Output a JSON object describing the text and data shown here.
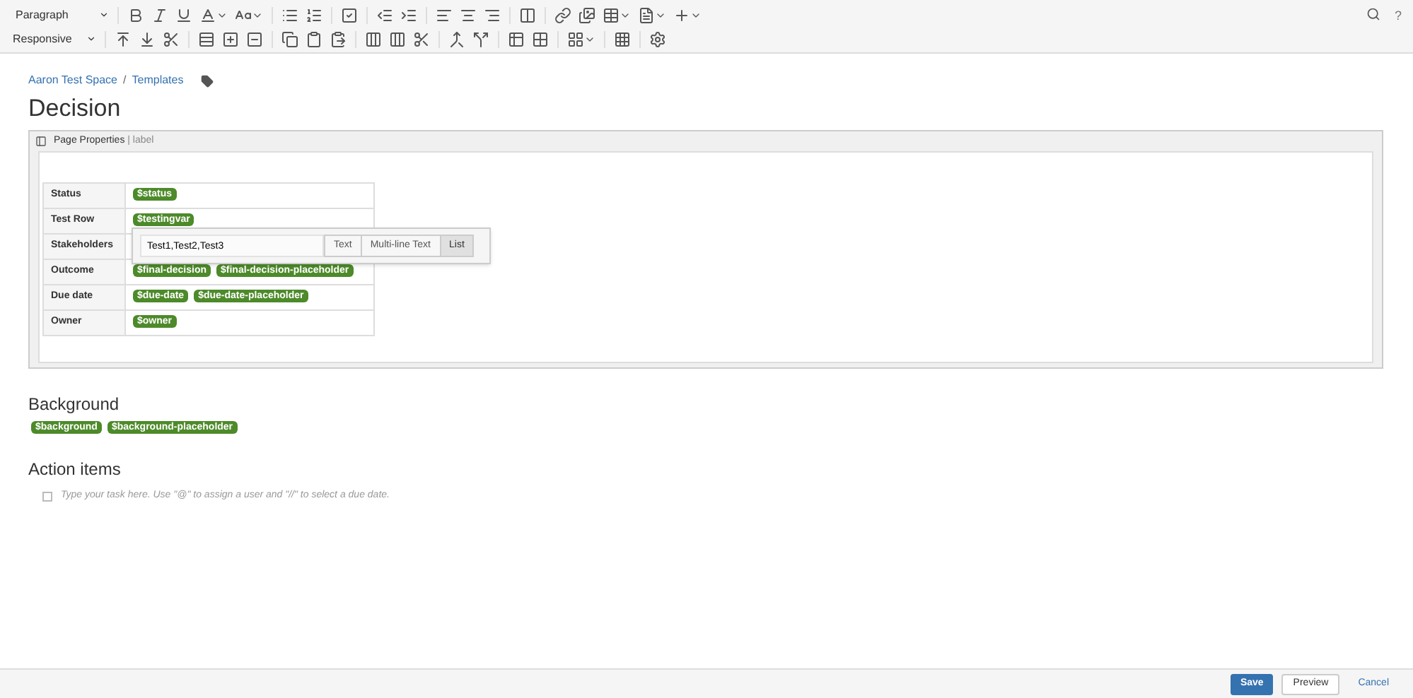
{
  "toolbar": {
    "format_dropdown": "Paragraph",
    "layout_dropdown": "Responsive",
    "help": "?"
  },
  "breadcrumbs": [
    {
      "label": "Aaron Test Space"
    },
    {
      "label": "Templates"
    }
  ],
  "breadcrumb_separator": "/",
  "title": "Decision",
  "macro": {
    "name": "Page Properties",
    "params": "| label"
  },
  "properties": [
    {
      "label": "Status",
      "values": [
        "$status"
      ]
    },
    {
      "label": "Test Row",
      "values": [
        "$testingvar"
      ]
    },
    {
      "label": "Stakeholders"
    },
    {
      "label": "Outcome",
      "values": [
        "$final-decision",
        "$final-decision-placeholder"
      ]
    },
    {
      "label": "Due date",
      "values": [
        "$due-date",
        "$due-date-placeholder"
      ]
    },
    {
      "label": "Owner",
      "values": [
        "$owner"
      ]
    }
  ],
  "variable_popup": {
    "value": "Test1,Test2,Test3",
    "types": [
      {
        "label": "Text",
        "selected": false
      },
      {
        "label": "Multi-line Text",
        "selected": false
      },
      {
        "label": "List",
        "selected": true
      }
    ]
  },
  "sections": [
    {
      "kind": "variables",
      "heading": "Background",
      "values": [
        "$background",
        "$background-placeholder"
      ]
    },
    {
      "kind": "tasks",
      "heading": "Action items",
      "tasks": [
        {
          "placeholder": "Type your task here. Use \"@\" to assign a user and \"//\" to select a due date.",
          "checked": false
        }
      ]
    }
  ],
  "footer": {
    "buttons": [
      {
        "label": "Save",
        "kind": "primary"
      },
      {
        "label": "Preview",
        "kind": "default"
      },
      {
        "label": "Cancel",
        "kind": "link"
      }
    ]
  }
}
